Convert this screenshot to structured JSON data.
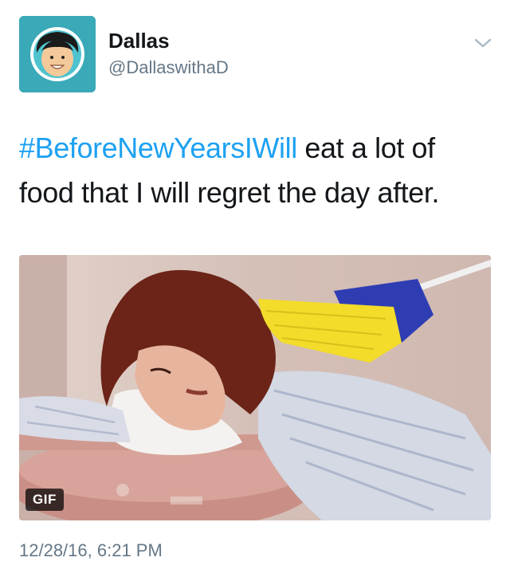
{
  "author": {
    "name": "Dallas",
    "handle": "@DallaswithaD"
  },
  "tweet": {
    "hashtag": "#BeforeNewYearsIWill",
    "text": " eat a lot of food that I will regret the day after."
  },
  "media": {
    "badge": "GIF"
  },
  "timestamp": "12/28/16, 6:21 PM",
  "icons": {
    "menu": "chevron-down-icon",
    "avatar": "cartoon-face-avatar"
  },
  "colors": {
    "link": "#1da1f2",
    "secondary_text": "#657786",
    "avatar_bg": "#3aa9b8"
  }
}
